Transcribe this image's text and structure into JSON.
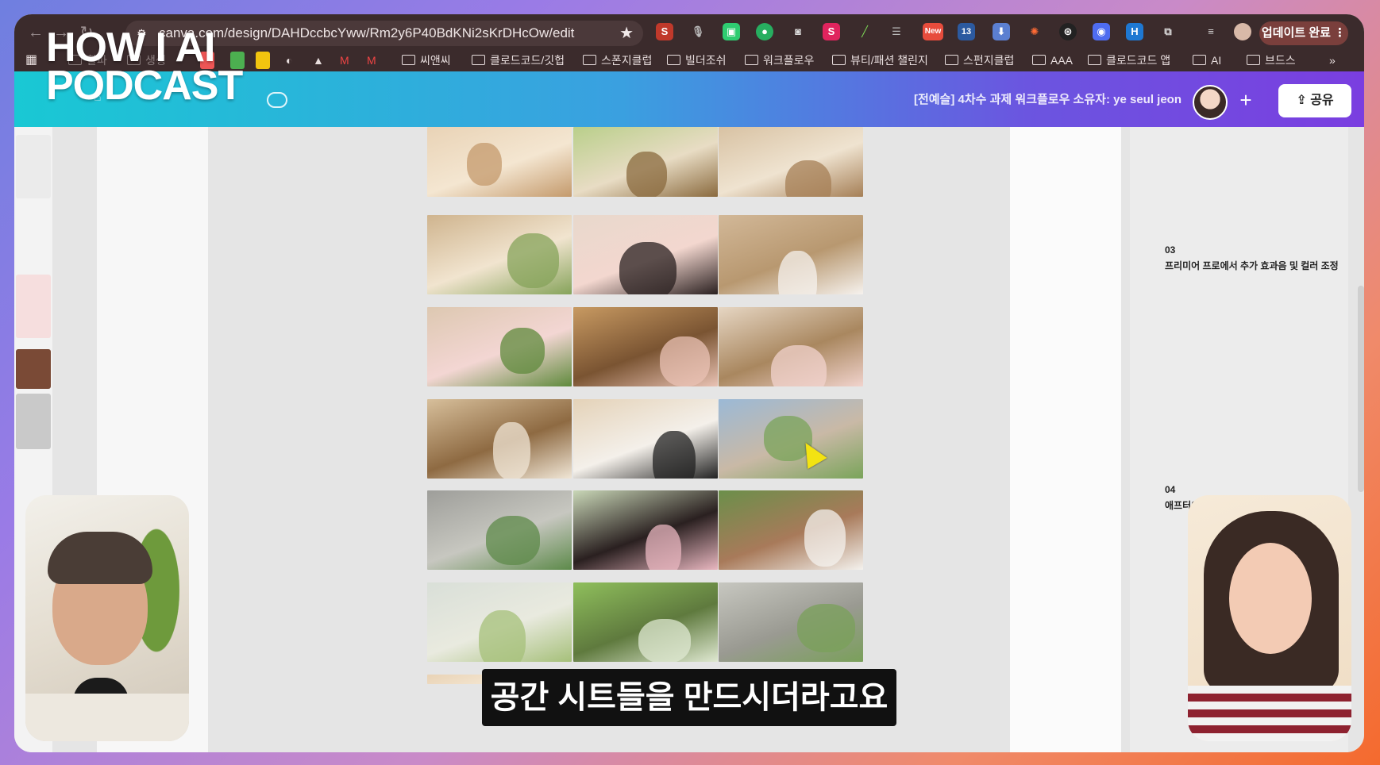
{
  "browser": {
    "url": "canva.com/design/DAHDccbcYww/Rm2y6P40BdKNi2sKrDHcOw/edit",
    "update_label": "업데이트 완료",
    "ext_new_badge": "New",
    "ext_count_badge": "13",
    "bookmarks": [
      "씨앤씨",
      "클로드코드/깃헙",
      "스폰지클럽",
      "빌더조쉬",
      "워크플로우",
      "뷰티/패션 챌린지",
      "스펀지클럽",
      "AAA",
      "클로드코드 앱",
      "AI",
      "브드스"
    ],
    "bookmark_faded_1": "할파",
    "bookmark_faded_2": "생생"
  },
  "canva": {
    "doc_title": "[전예슬] 4차수 과제 워크플로우 소유자: ye seul jeon",
    "share_label": "공유"
  },
  "steps": [
    {
      "number": "03",
      "text": "프리미어 프로에서 추가 효과음 및 컬러 조정"
    },
    {
      "number": "04",
      "text": "애프터이펙트"
    }
  ],
  "overlay": {
    "logo_line1": "HOW I AI",
    "logo_line2": "PODCAST",
    "caption": "공간 시트들을 만드시더라고요"
  },
  "photos": [
    "window-sill",
    "garden-window",
    "rug-sofa",
    "living-room",
    "woman-waving",
    "dog-on-rug",
    "woman-window",
    "lunch-box",
    "woman-with-dog",
    "empty-room",
    "woman-room",
    "street-cyclist",
    "bicycle-wheel",
    "woman-outdoor",
    "dog-outdoor",
    "apartments",
    "park-trees",
    "street-wall"
  ],
  "colors": {
    "canva_gradient_start": "#19c8d4",
    "canva_gradient_end": "#7a3ee0",
    "browser_bar": "#3b2b2c"
  }
}
